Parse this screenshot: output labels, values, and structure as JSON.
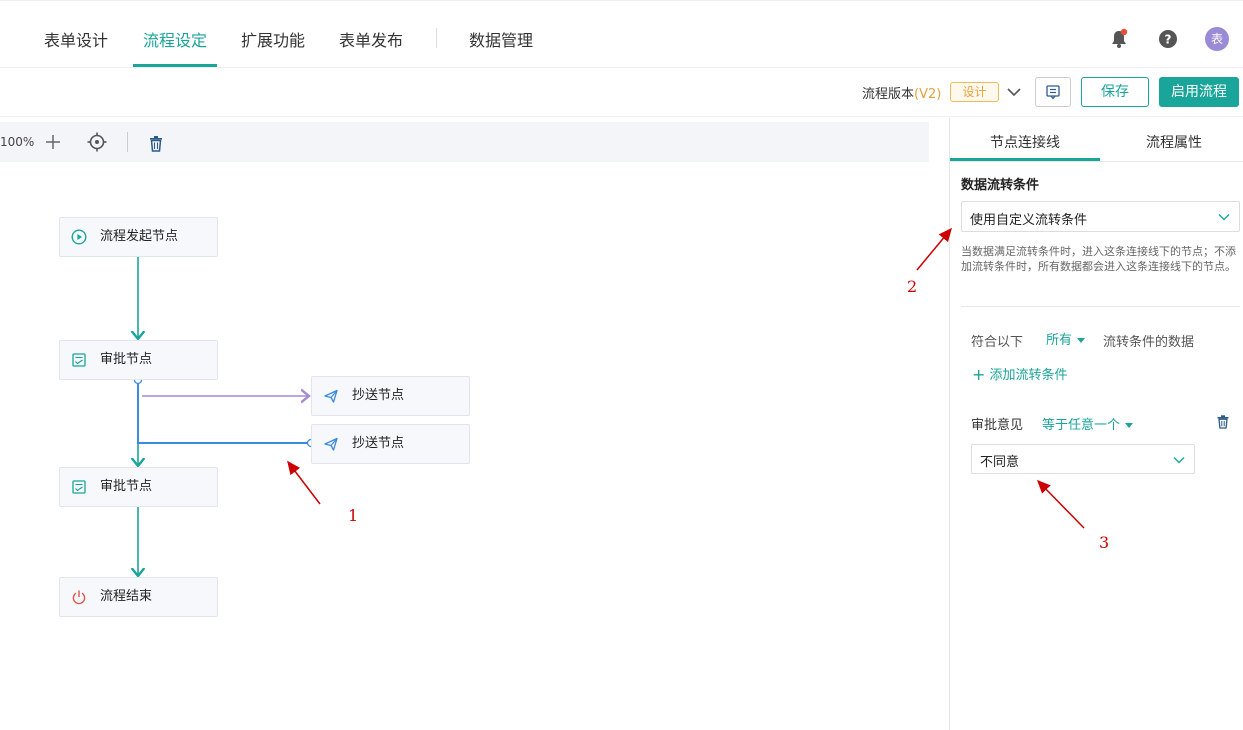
{
  "topnav": {
    "tabs": [
      {
        "label": "表单设计"
      },
      {
        "label": "流程设定"
      },
      {
        "label": "扩展功能"
      },
      {
        "label": "表单发布"
      },
      {
        "label": "数据管理"
      }
    ],
    "active_tab": "流程设定",
    "avatar_text": "表"
  },
  "toolbar": {
    "version_prefix": "流程版本",
    "version_value": "(V2)",
    "design_badge": "设计",
    "save_label": "保存",
    "enable_label": "启用流程"
  },
  "canvas": {
    "zoom": "100%",
    "nodes": {
      "start": "流程发起节点",
      "approve1": "审批节点",
      "cc1": "抄送节点",
      "cc2": "抄送节点",
      "approve2": "审批节点",
      "end": "流程结束"
    }
  },
  "annotations": [
    "1",
    "2",
    "3"
  ],
  "side_panel": {
    "tabs": [
      {
        "label": "节点连接线"
      },
      {
        "label": "流程属性"
      }
    ],
    "section_title": "数据流转条件",
    "condition_mode": "使用自定义流转条件",
    "help_text": "当数据满足流转条件时，进入这条连接线下的节点；不添加流转条件时，所有数据都会进入这条连接线下的节点。",
    "match_prefix": "符合以下",
    "match_mode": "所有",
    "match_suffix": "流转条件的数据",
    "add_condition": "添加流转条件",
    "condition_field": "审批意见",
    "condition_operator": "等于任意一个",
    "condition_value": "不同意"
  },
  "colors": {
    "accent": "#1aa59a",
    "connector_purple": "#a58ad0",
    "connector_blue": "#3b8be0",
    "annotation_red": "#cc0000"
  }
}
